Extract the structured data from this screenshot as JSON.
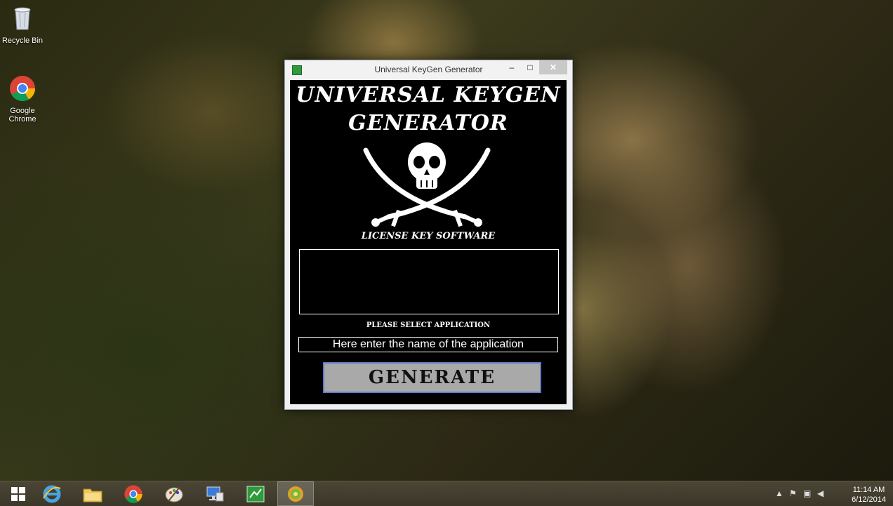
{
  "desktop": {
    "icons": [
      {
        "label": "Recycle Bin"
      },
      {
        "label": "Google Chrome"
      }
    ]
  },
  "window": {
    "title": "Universal KeyGen Generator",
    "controls": {
      "minimize": "–",
      "maximize": "□",
      "close": "✕"
    },
    "headline_line1": "UNIVERSAL KEYGEN",
    "headline_line2": "GENERATOR",
    "tagline": "LICENSE KEY SOFTWARE",
    "select_label": "PLEASE SELECT APPLICATION",
    "app_input_value": "Here enter the name of the application",
    "generate_label": "GENERATE",
    "output_value": ""
  },
  "taskbar": {
    "items": [
      "start-icon",
      "internet-explorer-icon",
      "file-explorer-icon",
      "chrome-icon",
      "paint-icon",
      "remote-desktop-icon",
      "keygen-app-icon",
      "media-app-icon"
    ],
    "active_item": "media-app-icon"
  },
  "tray": {
    "time": "11:14 AM",
    "date": "6/12/2014"
  },
  "colors": {
    "window_client_bg": "#000000",
    "generate_bg": "#a9a9a9",
    "generate_border": "#5c7cc8",
    "close_button": "#c9c9c9"
  }
}
